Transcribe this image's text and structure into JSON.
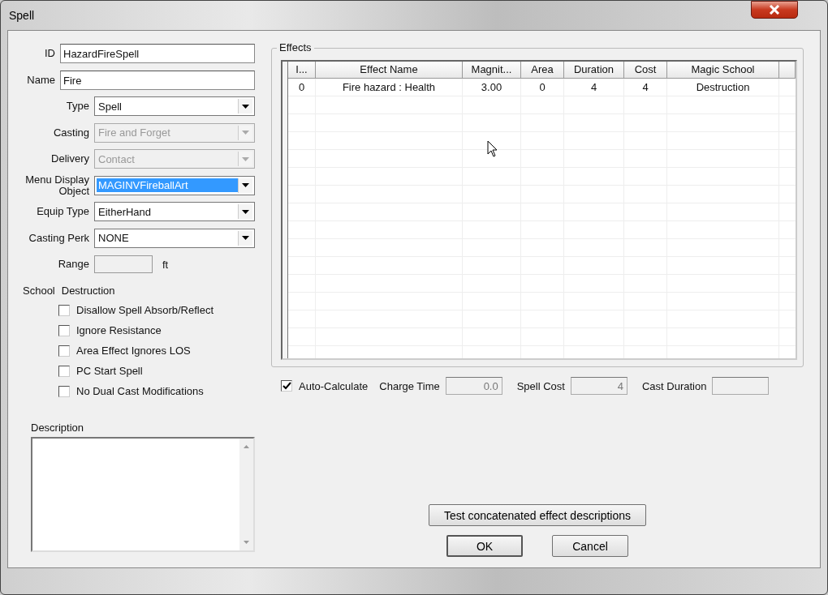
{
  "window": {
    "title": "Spell"
  },
  "fields": [
    {
      "label": "ID",
      "kind": "text",
      "value": "HazardFireSpell"
    },
    {
      "label": "Name",
      "kind": "text",
      "value": "Fire"
    },
    {
      "label": "Type",
      "kind": "dropdown",
      "value": "Spell",
      "disabled": false,
      "highlighted": false
    },
    {
      "label": "Casting",
      "kind": "dropdown",
      "value": "Fire and Forget",
      "disabled": true,
      "highlighted": false
    },
    {
      "label": "Delivery",
      "kind": "dropdown",
      "value": "Contact",
      "disabled": true,
      "highlighted": false
    },
    {
      "label": "Menu Display Object",
      "kind": "dropdown",
      "value": "MAGINVFireballArt",
      "disabled": false,
      "highlighted": true
    },
    {
      "label": "Equip Type",
      "kind": "dropdown",
      "value": "EitherHand",
      "disabled": false,
      "highlighted": false
    },
    {
      "label": "Casting Perk",
      "kind": "dropdown",
      "value": "NONE",
      "disabled": false,
      "highlighted": false
    },
    {
      "label": "Range",
      "kind": "unit",
      "unit": "ft",
      "disabled": true
    }
  ],
  "school": {
    "label": "School",
    "value": "Destruction"
  },
  "checkboxes": [
    {
      "label": "Disallow Spell Absorb/Reflect",
      "checked": false
    },
    {
      "label": "Ignore Resistance",
      "checked": false
    },
    {
      "label": "Area Effect Ignores LOS",
      "checked": false
    },
    {
      "label": "PC Start Spell",
      "checked": false
    },
    {
      "label": "No Dual Cast Modifications",
      "checked": false
    }
  ],
  "description": {
    "label": "Description"
  },
  "effects": {
    "title": "Effects",
    "columns": [
      "I...",
      "Effect Name",
      "Magnit...",
      "Area",
      "Duration",
      "Cost",
      "Magic School"
    ],
    "rows": [
      [
        "0",
        "Fire hazard : Health",
        "3.00",
        "0",
        "4",
        "4",
        "Destruction"
      ]
    ]
  },
  "auto_calculate": {
    "label": "Auto-Calculate",
    "checked": true
  },
  "stats": [
    {
      "label": "Charge Time",
      "value": "0.0"
    },
    {
      "label": "Spell Cost",
      "value": "4"
    },
    {
      "label": "Cast Duration"
    }
  ],
  "test_button": "Test concatenated effect descriptions",
  "buttons": [
    "OK",
    "Cancel"
  ]
}
